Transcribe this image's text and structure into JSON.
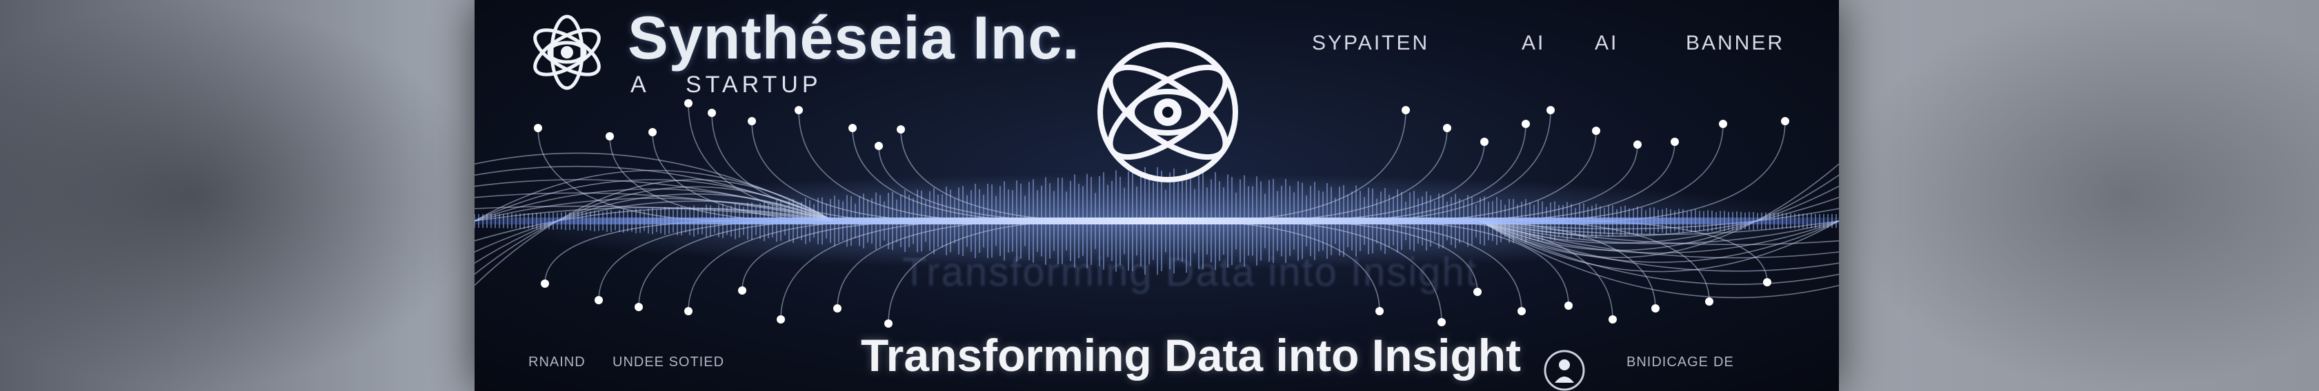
{
  "brand": {
    "name": "Synthéseia Inc.",
    "sub_a": "A",
    "sub_b": "STARTUP"
  },
  "nav": {
    "item1": "SYPAITEN",
    "item2": "AI",
    "item3": "AI",
    "item4": "BANNER"
  },
  "ghost_text": "Transforming Data into Insight",
  "tagline": "Transforming Data into Insight",
  "footer": {
    "left1": "RNAIND",
    "left2": "UNDEE SOTIED",
    "right1": "BNIDICAGE",
    "right2": "DE"
  },
  "colors": {
    "banner_bg": "#0c1222",
    "accent_glow": "#7fa6ff",
    "text": "#f2f4f8"
  },
  "icons": {
    "brand_logo": "atom-eye-icon",
    "center_logo": "atom-eye-icon",
    "footer_icon": "person-circle-icon"
  }
}
